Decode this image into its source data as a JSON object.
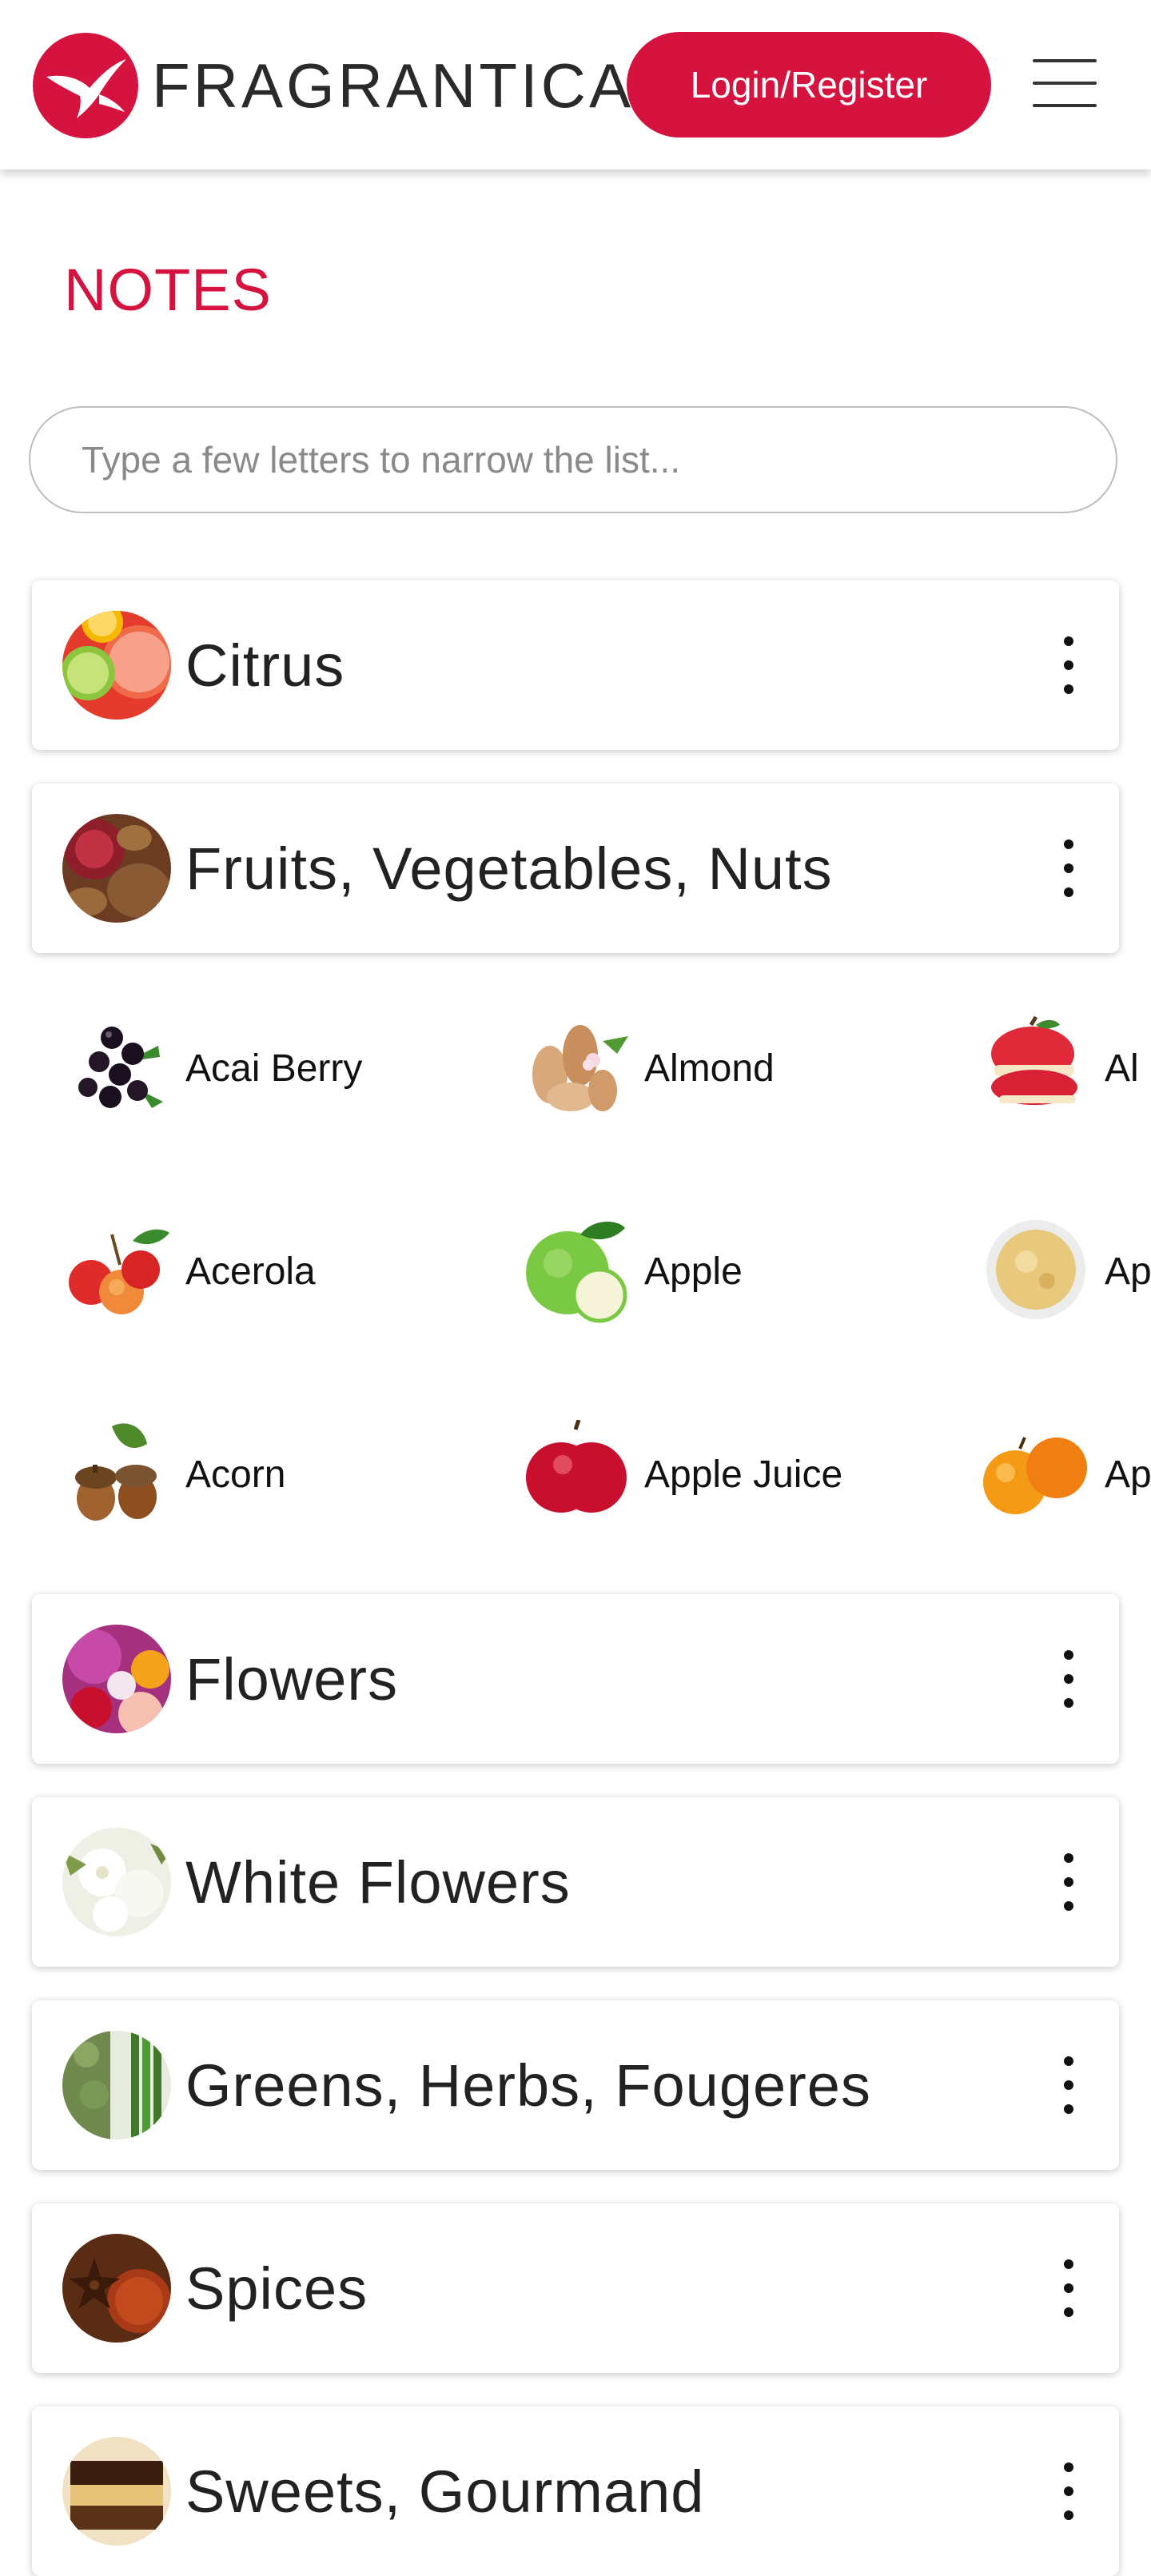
{
  "header": {
    "brand": "FRAGRANTICA",
    "login_label": "Login/Register",
    "brand_color": "#d6123f"
  },
  "page": {
    "title": "NOTES",
    "search_placeholder": "Type a few letters to narrow the list..."
  },
  "categories": [
    {
      "label": "Citrus",
      "icon": "citrus-icon"
    },
    {
      "label": "Fruits, Vegetables, Nuts",
      "icon": "fruits-icon"
    },
    {
      "label": "Flowers",
      "icon": "flowers-icon"
    },
    {
      "label": "White Flowers",
      "icon": "white-flowers-icon"
    },
    {
      "label": "Greens, Herbs, Fougeres",
      "icon": "herbs-icon"
    },
    {
      "label": "Spices",
      "icon": "spices-icon"
    },
    {
      "label": "Sweets, Gourmand",
      "icon": "sweets-icon"
    }
  ],
  "notes": [
    {
      "label": "Acai Berry",
      "icon": "acai-berry-icon"
    },
    {
      "label": "Almond",
      "icon": "almond-icon"
    },
    {
      "label": "Al",
      "icon": "apple-slices-icon"
    },
    {
      "label": "Acerola",
      "icon": "acerola-icon"
    },
    {
      "label": "Apple",
      "icon": "green-apple-icon"
    },
    {
      "label": "Ap",
      "icon": "applesauce-icon"
    },
    {
      "label": "Acorn",
      "icon": "acorn-icon"
    },
    {
      "label": "Apple Juice",
      "icon": "red-apple-icon"
    },
    {
      "label": "Ap",
      "icon": "apricot-icon"
    }
  ]
}
